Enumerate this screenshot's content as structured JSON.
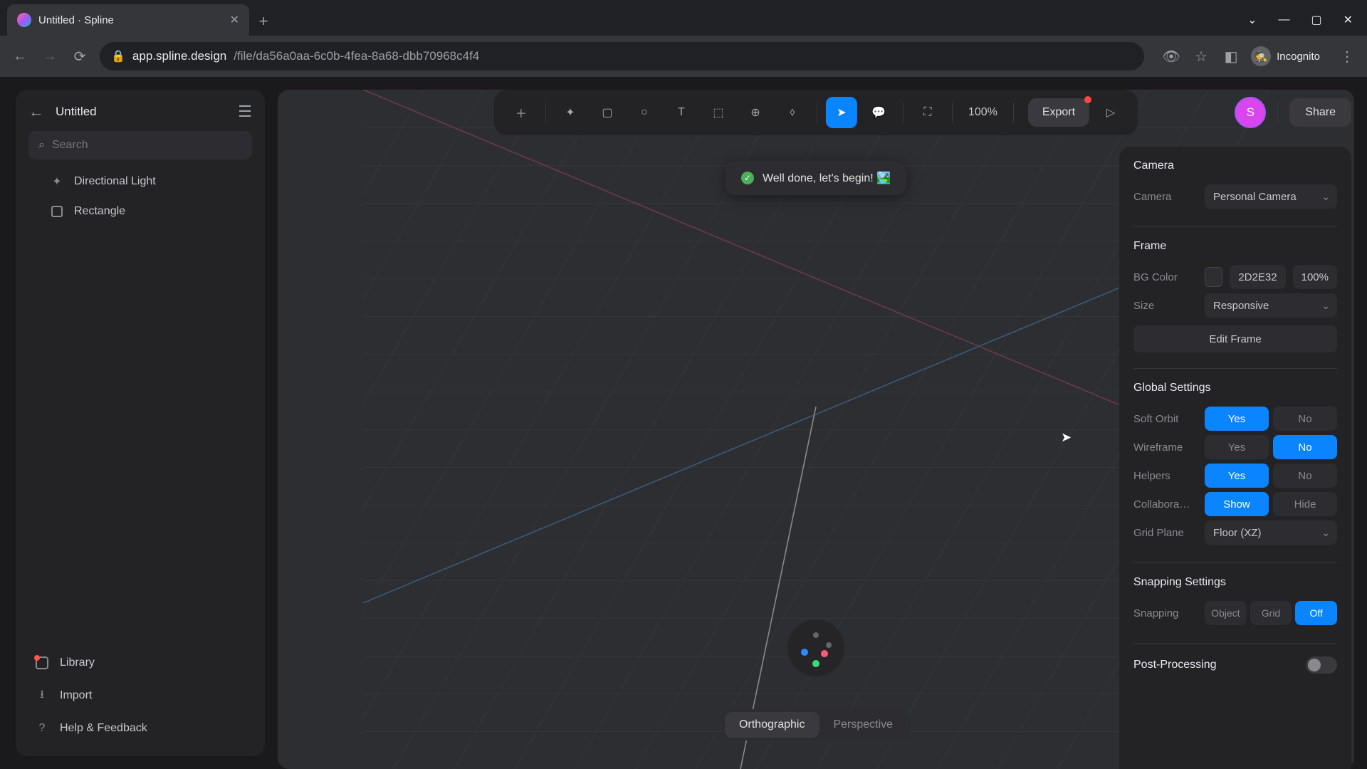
{
  "browser": {
    "tab_title": "Untitled · Spline",
    "url_domain": "app.spline.design",
    "url_path": "/file/da56a0aa-6c0b-4fea-8a68-dbb70968c4f4",
    "incognito_label": "Incognito"
  },
  "sidebar": {
    "project_title": "Untitled",
    "search_placeholder": "Search",
    "layers": [
      {
        "name": "Directional Light",
        "icon": "light"
      },
      {
        "name": "Rectangle",
        "icon": "rect"
      }
    ],
    "footer": {
      "library": "Library",
      "import": "Import",
      "help": "Help & Feedback"
    }
  },
  "toolbar": {
    "zoom": "100%",
    "export": "Export"
  },
  "toast": {
    "message": "Well done, let's begin! 🏞️"
  },
  "view": {
    "orthographic": "Orthographic",
    "perspective": "Perspective"
  },
  "top_right": {
    "avatar_initial": "S",
    "share": "Share"
  },
  "panel": {
    "camera": {
      "title": "Camera",
      "label": "Camera",
      "value": "Personal Camera"
    },
    "frame": {
      "title": "Frame",
      "bg_label": "BG Color",
      "bg_hex": "2D2E32",
      "bg_opacity": "100%",
      "size_label": "Size",
      "size_value": "Responsive",
      "edit_button": "Edit Frame"
    },
    "global": {
      "title": "Global Settings",
      "soft_orbit": {
        "label": "Soft Orbit",
        "yes": "Yes",
        "no": "No"
      },
      "wireframe": {
        "label": "Wireframe",
        "yes": "Yes",
        "no": "No"
      },
      "helpers": {
        "label": "Helpers",
        "yes": "Yes",
        "no": "No"
      },
      "collab": {
        "label": "Collabora…",
        "show": "Show",
        "hide": "Hide"
      },
      "grid_plane": {
        "label": "Grid Plane",
        "value": "Floor (XZ)"
      }
    },
    "snapping": {
      "title": "Snapping Settings",
      "label": "Snapping",
      "object": "Object",
      "grid": "Grid",
      "off": "Off"
    },
    "post": {
      "title": "Post-Processing"
    }
  }
}
